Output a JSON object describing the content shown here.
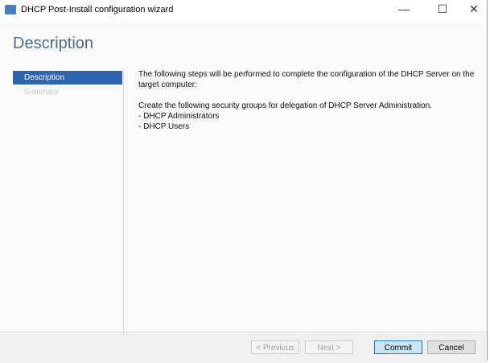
{
  "window": {
    "title": "DHCP Post-Install configuration wizard",
    "minimize": "—",
    "maximize": "☐",
    "close": "✕"
  },
  "page": {
    "heading": "Description"
  },
  "sidebar": {
    "items": [
      {
        "label": "Description"
      },
      {
        "label": "Summary"
      }
    ]
  },
  "content": {
    "intro": "The following steps will be performed to complete the configuration of the DHCP Server on the target computer:",
    "groups_intro": "Create the following security groups for delegation of DHCP Server Administration.",
    "groups": [
      "- DHCP Administrators",
      "- DHCP Users"
    ]
  },
  "footer": {
    "previous": "< Previous",
    "next": "Next >",
    "commit": "Commit",
    "cancel": "Cancel"
  }
}
